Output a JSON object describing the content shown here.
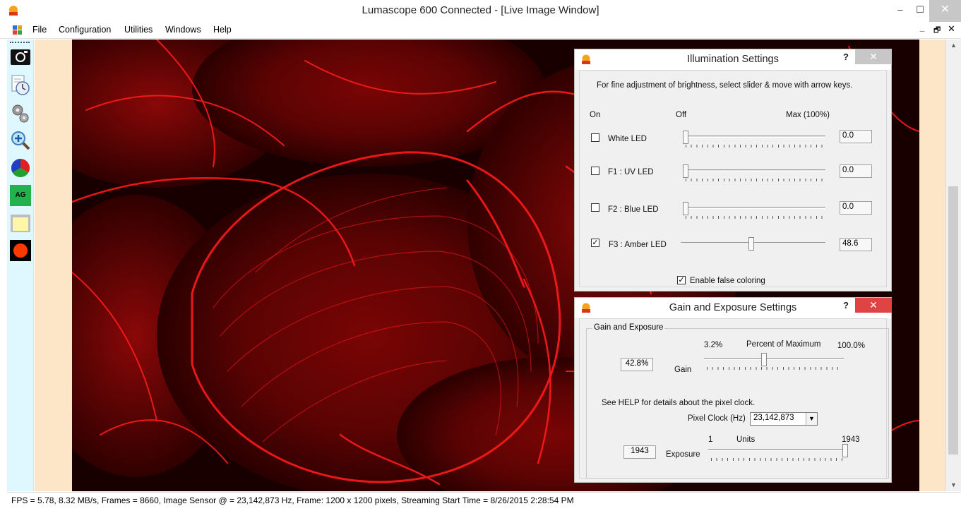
{
  "window": {
    "title": "Lumascope 600 Connected - [Live Image Window]",
    "minimize": "–",
    "maximize": "☐",
    "close": "✕"
  },
  "menu": {
    "items": [
      "File",
      "Configuration",
      "Utilities",
      "Windows",
      "Help"
    ],
    "mdi_min": "_",
    "mdi_restore": "🗗",
    "mdi_close": "✕"
  },
  "toolbar": {
    "items": [
      "camera-icon",
      "time-lapse-icon",
      "settings-gears-icon",
      "zoom-in-icon",
      "color-wheel-icon",
      "auto-gain-icon",
      "folder-icon",
      "record-icon"
    ],
    "auto_gain_label": "AG"
  },
  "status": {
    "text": "FPS = 5.78, 8.32 MB/s, Frames = 8660, Image Sensor @ = 23,142,873 Hz, Frame: 1200 x 1200 pixels, Streaming Start Time = 8/26/2015 2:28:54 PM"
  },
  "illumination": {
    "title": "Illumination Settings",
    "help": "?",
    "close": "✕",
    "instructions": "For fine adjustment of brightness, select slider & move with arrow keys.",
    "col_on": "On",
    "col_off": "Off",
    "col_max": "Max (100%)",
    "leds": [
      {
        "label": "White LED",
        "checked": false,
        "value": "0.0",
        "level": 0.0
      },
      {
        "label": "F1 : UV LED",
        "checked": false,
        "value": "0.0",
        "level": 0.0
      },
      {
        "label": "F2 : Blue LED",
        "checked": false,
        "value": "0.0",
        "level": 0.0
      },
      {
        "label": "F3 : Amber LED",
        "checked": true,
        "value": "48.6",
        "level": 48.6
      }
    ],
    "false_color_label": "Enable false coloring",
    "false_color_checked": true
  },
  "gain": {
    "title": "Gain and Exposure Settings",
    "help": "?",
    "close": "✕",
    "group_label": "Gain and Exposure",
    "min_label": "3.2%",
    "mid_label": "Percent of Maximum",
    "max_label": "100.0%",
    "gain_value": "42.8%",
    "gain_label": "Gain",
    "gain_level": 42.8,
    "help_note": "See HELP for details about the pixel clock.",
    "pixel_clock_label": "Pixel Clock (Hz)",
    "pixel_clock_value": "23,142,873",
    "units_min": "1",
    "units_label": "Units",
    "units_max": "1943",
    "exposure_value": "1943",
    "exposure_label": "Exposure",
    "exposure_level": 100
  },
  "colors": {
    "close_red": "#e04343",
    "image_red": "#ff1a1a",
    "peach": "#fde5c8",
    "toolbar_bg": "#dff7ff"
  }
}
